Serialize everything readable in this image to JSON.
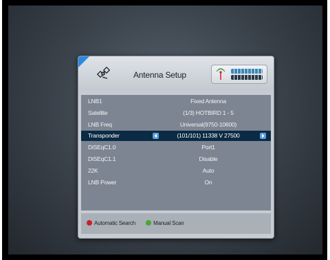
{
  "header": {
    "title": "Antenna Setup",
    "signal": {
      "strength": 1.0,
      "quality": 1.0
    }
  },
  "rows": [
    {
      "label": "LNB1",
      "value": "Fixed Antenna"
    },
    {
      "label": "Satellite",
      "value": "(1/3) HOTBIRD 1 - 5"
    },
    {
      "label": "LNB Freq",
      "value": "Universal(9750-10600)"
    },
    {
      "label": "Transponder",
      "value": "(101/101) 11338 V 27500"
    },
    {
      "label": "DiSEqC1.0",
      "value": "Port1"
    },
    {
      "label": "DiSEqC1.1",
      "value": "Disable"
    },
    {
      "label": "22K",
      "value": "Auto"
    },
    {
      "label": "LNB Power",
      "value": "On"
    }
  ],
  "footer": {
    "red_label": "Automatic Search",
    "green_label": "Manual Scan"
  },
  "colors": {
    "selected_row": "#0b2a44",
    "accent": "#2a8be0",
    "red_button": "#c8202a",
    "green_button": "#4aa82e"
  },
  "icons": {
    "header": "satellite-icon",
    "signal": "antenna-icon",
    "row_nav_left": "arrow-left-icon",
    "row_nav_right": "arrow-right-icon"
  }
}
